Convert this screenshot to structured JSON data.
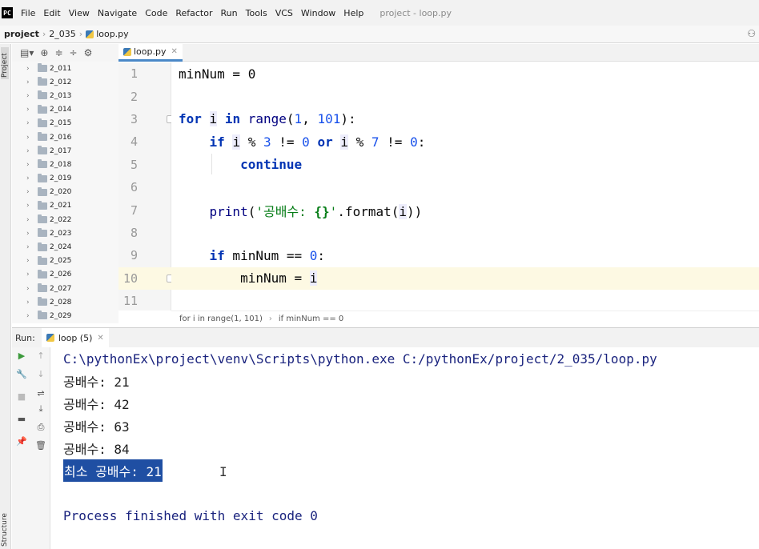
{
  "menu": {
    "logo": "PC",
    "items": [
      "File",
      "Edit",
      "View",
      "Navigate",
      "Code",
      "Refactor",
      "Run",
      "Tools",
      "VCS",
      "Window",
      "Help"
    ],
    "window_title": "project - loop.py"
  },
  "navbar": {
    "project": "project",
    "folder": "2_035",
    "file": "loop.py"
  },
  "side_tabs": {
    "project": "Project",
    "structure": "Structure"
  },
  "project_tree": {
    "folders": [
      "2_011",
      "2_012",
      "2_013",
      "2_014",
      "2_015",
      "2_016",
      "2_017",
      "2_018",
      "2_019",
      "2_020",
      "2_021",
      "2_022",
      "2_023",
      "2_024",
      "2_025",
      "2_026",
      "2_027",
      "2_028",
      "2_029"
    ]
  },
  "editor": {
    "tab_label": "loop.py",
    "line_numbers": [
      "1",
      "2",
      "3",
      "4",
      "5",
      "6",
      "7",
      "8",
      "9",
      "10",
      "11"
    ],
    "current_line": "10",
    "code": {
      "l1": "minNum = 0",
      "l3_kw_for": "for",
      "l3_var": "i",
      "l3_kw_in": "in",
      "l3_fn": "range",
      "l3_open": "(",
      "l3_num1": "1",
      "l3_comma": ", ",
      "l3_num2": "101",
      "l3_close": "):",
      "l4_kw_if": "if",
      "l4_var1": "i",
      "l4_op1": " % ",
      "l4_num1": "3",
      "l4_op2": " != ",
      "l4_num2": "0",
      "l4_kw_or": "or",
      "l4_var2": "i",
      "l4_op3": " % ",
      "l4_num3": "7",
      "l4_op4": " != ",
      "l4_num4": "0",
      "l4_colon": ":",
      "l5_kw": "continue",
      "l7_fn": "print",
      "l7_open": "(",
      "l7_str1": "'공배수: ",
      "l7_fmt": "{}",
      "l7_str2": "'",
      "l7_method": ".format(",
      "l7_var": "i",
      "l7_close": "))",
      "l9_kw": "if",
      "l9_rest": " minNum == ",
      "l9_num": "0",
      "l9_colon": ":",
      "l10_lhs": "minNum = ",
      "l10_var": "i"
    },
    "breadcrumb": [
      "for i in range(1, 101)",
      "if minNum == 0"
    ]
  },
  "run": {
    "label": "Run:",
    "tab": "loop (5)",
    "output": [
      "C:\\pythonEx\\project\\venv\\Scripts\\python.exe C:/pythonEx/project/2_035/loop.py",
      "공배수: 21",
      "공배수: 42",
      "공배수: 63",
      "공배수: 84",
      "최소 공배수: 21",
      "",
      "Process finished with exit code 0"
    ]
  }
}
